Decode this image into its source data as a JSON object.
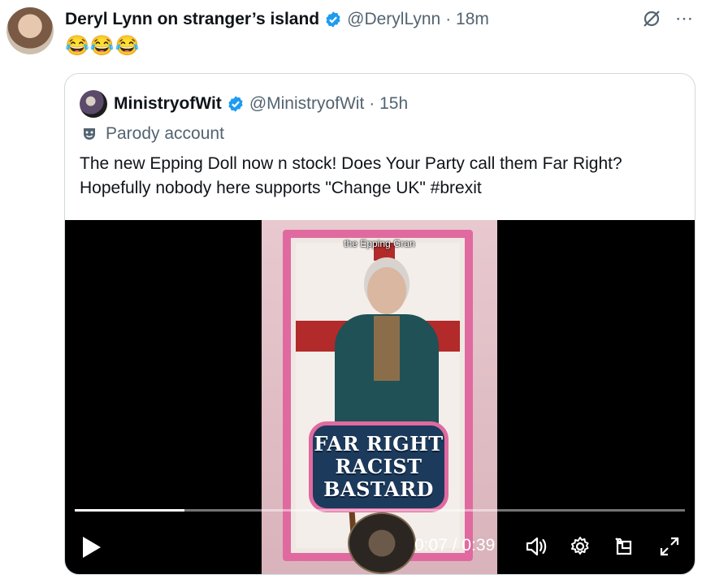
{
  "post": {
    "display_name": "Deryl Lynn on stranger’s island",
    "handle": "@DerylLynn",
    "time": "· 18m",
    "text": "😂😂😂"
  },
  "quote": {
    "display_name": "MinistryofWit",
    "handle": "@MinistryofWit",
    "time": "· 15h",
    "label": "Parody account",
    "text": "The new Epping Doll now n stock! Does Your Party call them Far Right? Hopefully nobody here supports \"Change UK\" #brexit"
  },
  "video": {
    "caption": "the Epping Gran",
    "plate_lines": [
      "FAR RIGHT",
      "RACIST",
      "BASTARD"
    ],
    "time_display": "0:07 / 0:39",
    "progress": 0.18
  },
  "icons": {
    "grok": "grok-icon",
    "more": "more-icon",
    "verified": "verified-badge-icon",
    "parody": "parody-mask-icon",
    "play": "play-icon",
    "volume": "volume-icon",
    "settings": "settings-gear-icon",
    "pip": "picture-in-picture-icon",
    "fullscreen": "fullscreen-icon"
  },
  "colors": {
    "verified": "#1d9bf0",
    "secondary_text": "#536471",
    "border": "#cfd9de"
  }
}
